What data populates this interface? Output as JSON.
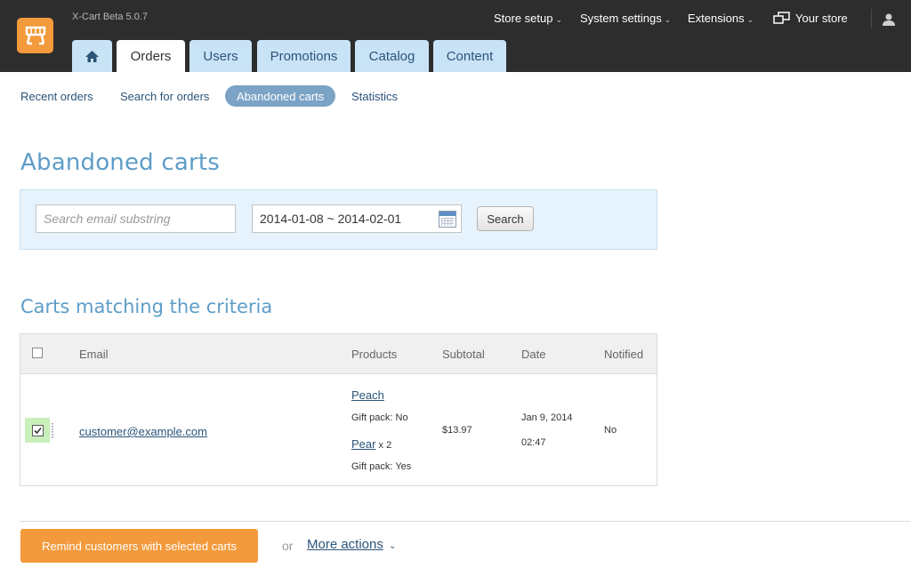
{
  "header": {
    "version": "X-Cart Beta 5.0.7",
    "nav": [
      {
        "label": "Store setup"
      },
      {
        "label": "System settings"
      },
      {
        "label": "Extensions"
      },
      {
        "label": "Your store"
      }
    ],
    "chevron": "⌄"
  },
  "tabs": [
    {
      "label": "Orders",
      "active": true
    },
    {
      "label": "Users"
    },
    {
      "label": "Promotions"
    },
    {
      "label": "Catalog"
    },
    {
      "label": "Content"
    }
  ],
  "subnav": [
    {
      "label": "Recent orders"
    },
    {
      "label": "Search for orders"
    },
    {
      "label": "Abandoned carts",
      "active": true
    },
    {
      "label": "Statistics"
    }
  ],
  "page": {
    "title": "Abandoned carts",
    "section_title": "Carts matching the criteria"
  },
  "search": {
    "email_placeholder": "Search email substring",
    "date_range": "2014-01-08 ~ 2014-02-01",
    "button": "Search"
  },
  "table": {
    "columns": [
      "Email",
      "Products",
      "Subtotal",
      "Date",
      "Notified"
    ],
    "rows": [
      {
        "checked": true,
        "email": "customer@example.com",
        "products": [
          {
            "name": "Peach",
            "qty": "",
            "option": "Gift pack: No"
          },
          {
            "name": "Pear",
            "qty": "x 2",
            "option": "Gift pack: Yes"
          }
        ],
        "subtotal": "$13.97",
        "date": "Jan 9, 2014",
        "time": "02:47",
        "notified": "No"
      }
    ]
  },
  "actions": {
    "remind": "Remind customers with selected carts",
    "or": "or",
    "more": "More actions",
    "more_chevron": "⌄"
  },
  "colors": {
    "accent": "#f39a3c",
    "header_bg": "#2d2d2d",
    "tab_bg": "#c9e3f6",
    "title": "#5d9dc8",
    "link": "#2b5479"
  }
}
